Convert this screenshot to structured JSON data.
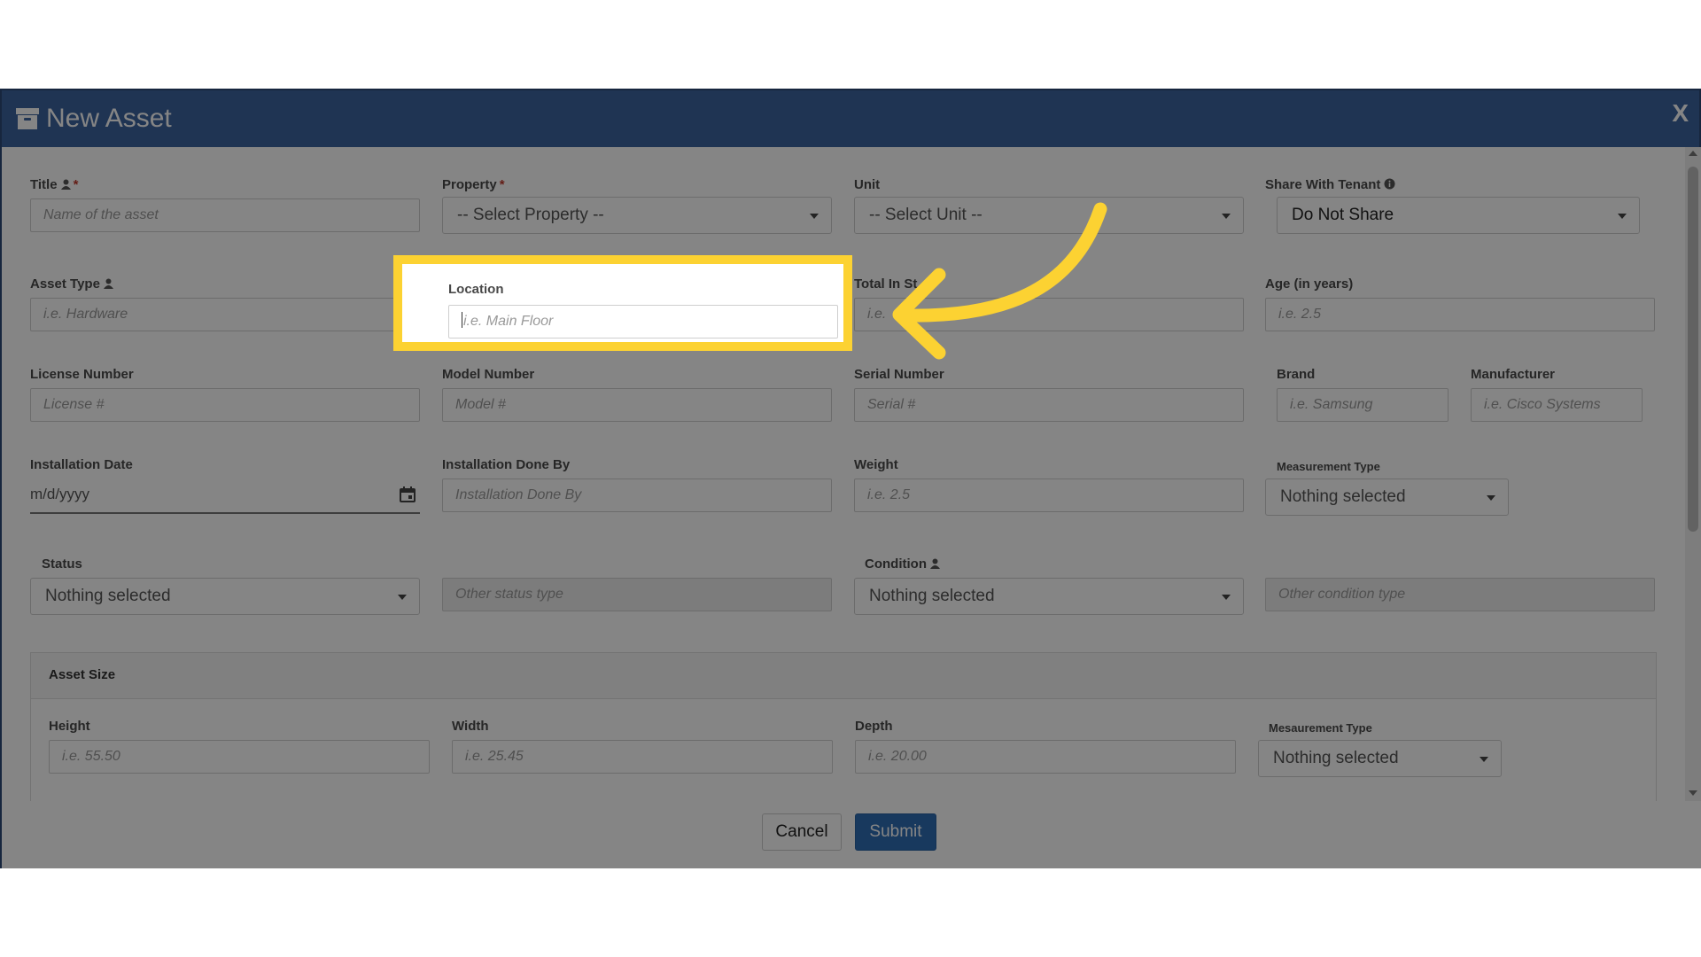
{
  "modal": {
    "title": "New Asset",
    "close_label": "X"
  },
  "fields": {
    "title": {
      "label": "Title",
      "required": "*",
      "placeholder": "Name of the asset"
    },
    "property": {
      "label": "Property",
      "required": "*",
      "value": "-- Select Property --"
    },
    "unit": {
      "label": "Unit",
      "value": "-- Select Unit --"
    },
    "share_with_tenant": {
      "label": "Share With Tenant",
      "value": "Do Not Share"
    },
    "asset_type": {
      "label": "Asset Type",
      "placeholder": "i.e. Hardware"
    },
    "location": {
      "label": "Location",
      "placeholder": "i.e. Main Floor"
    },
    "total_in_stock": {
      "label": "Total In St",
      "placeholder": "i.e."
    },
    "age": {
      "label": "Age (in years)",
      "placeholder": "i.e. 2.5"
    },
    "license_number": {
      "label": "License Number",
      "placeholder": "License #"
    },
    "model_number": {
      "label": "Model Number",
      "placeholder": "Model #"
    },
    "serial_number": {
      "label": "Serial Number",
      "placeholder": "Serial #"
    },
    "brand": {
      "label": "Brand",
      "placeholder": "i.e. Samsung"
    },
    "manufacturer": {
      "label": "Manufacturer",
      "placeholder": "i.e. Cisco Systems"
    },
    "installation_date": {
      "label": "Installation Date",
      "placeholder": "m/d/yyyy"
    },
    "installation_done_by": {
      "label": "Installation Done By",
      "placeholder": "Installation Done By"
    },
    "weight": {
      "label": "Weight",
      "placeholder": "i.e. 2.5"
    },
    "measurement_type": {
      "label": "Measurement Type",
      "value": "Nothing selected"
    },
    "status": {
      "label": "Status",
      "value": "Nothing selected"
    },
    "other_status": {
      "placeholder": "Other status type"
    },
    "condition": {
      "label": "Condition",
      "value": "Nothing selected"
    },
    "other_condition": {
      "placeholder": "Other condition type"
    }
  },
  "asset_size": {
    "heading": "Asset Size",
    "height": {
      "label": "Height",
      "placeholder": "i.e. 55.50"
    },
    "width": {
      "label": "Width",
      "placeholder": "i.e. 25.45"
    },
    "depth": {
      "label": "Depth",
      "placeholder": "i.e. 20.00"
    },
    "measurement_type": {
      "label": "Mesaurement Type",
      "value": "Nothing selected"
    }
  },
  "footer": {
    "cancel_label": "Cancel",
    "submit_label": "Submit"
  },
  "colors": {
    "header": "#3c64a0",
    "highlight": "#fcd232",
    "submit": "#2f6db5"
  },
  "icons": {
    "title": "archive-box-icon",
    "user": "user-icon",
    "info": "info-circle-icon",
    "calendar": "calendar-icon",
    "arrow": "curved-arrow-icon"
  }
}
